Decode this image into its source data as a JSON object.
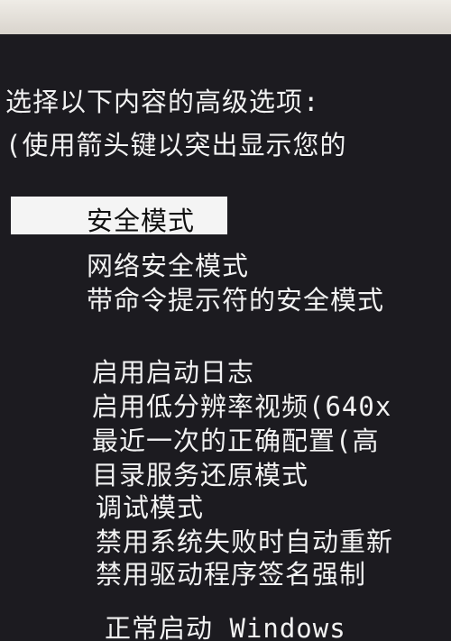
{
  "header": {
    "line1": "选择以下内容的高级选项:",
    "line2": "(使用箭头键以突出显示您的"
  },
  "menu": {
    "selected_label": "安全模式",
    "items": [
      "网络安全模式",
      "带命令提示符的安全模式",
      "启用启动日志",
      "启用低分辨率视频(640x",
      "最近一次的正确配置(高",
      "目录服务还原模式",
      "调试模式",
      "禁用系统失败时自动重新",
      "禁用驱动程序签名强制",
      "正常启动 Windows"
    ]
  }
}
